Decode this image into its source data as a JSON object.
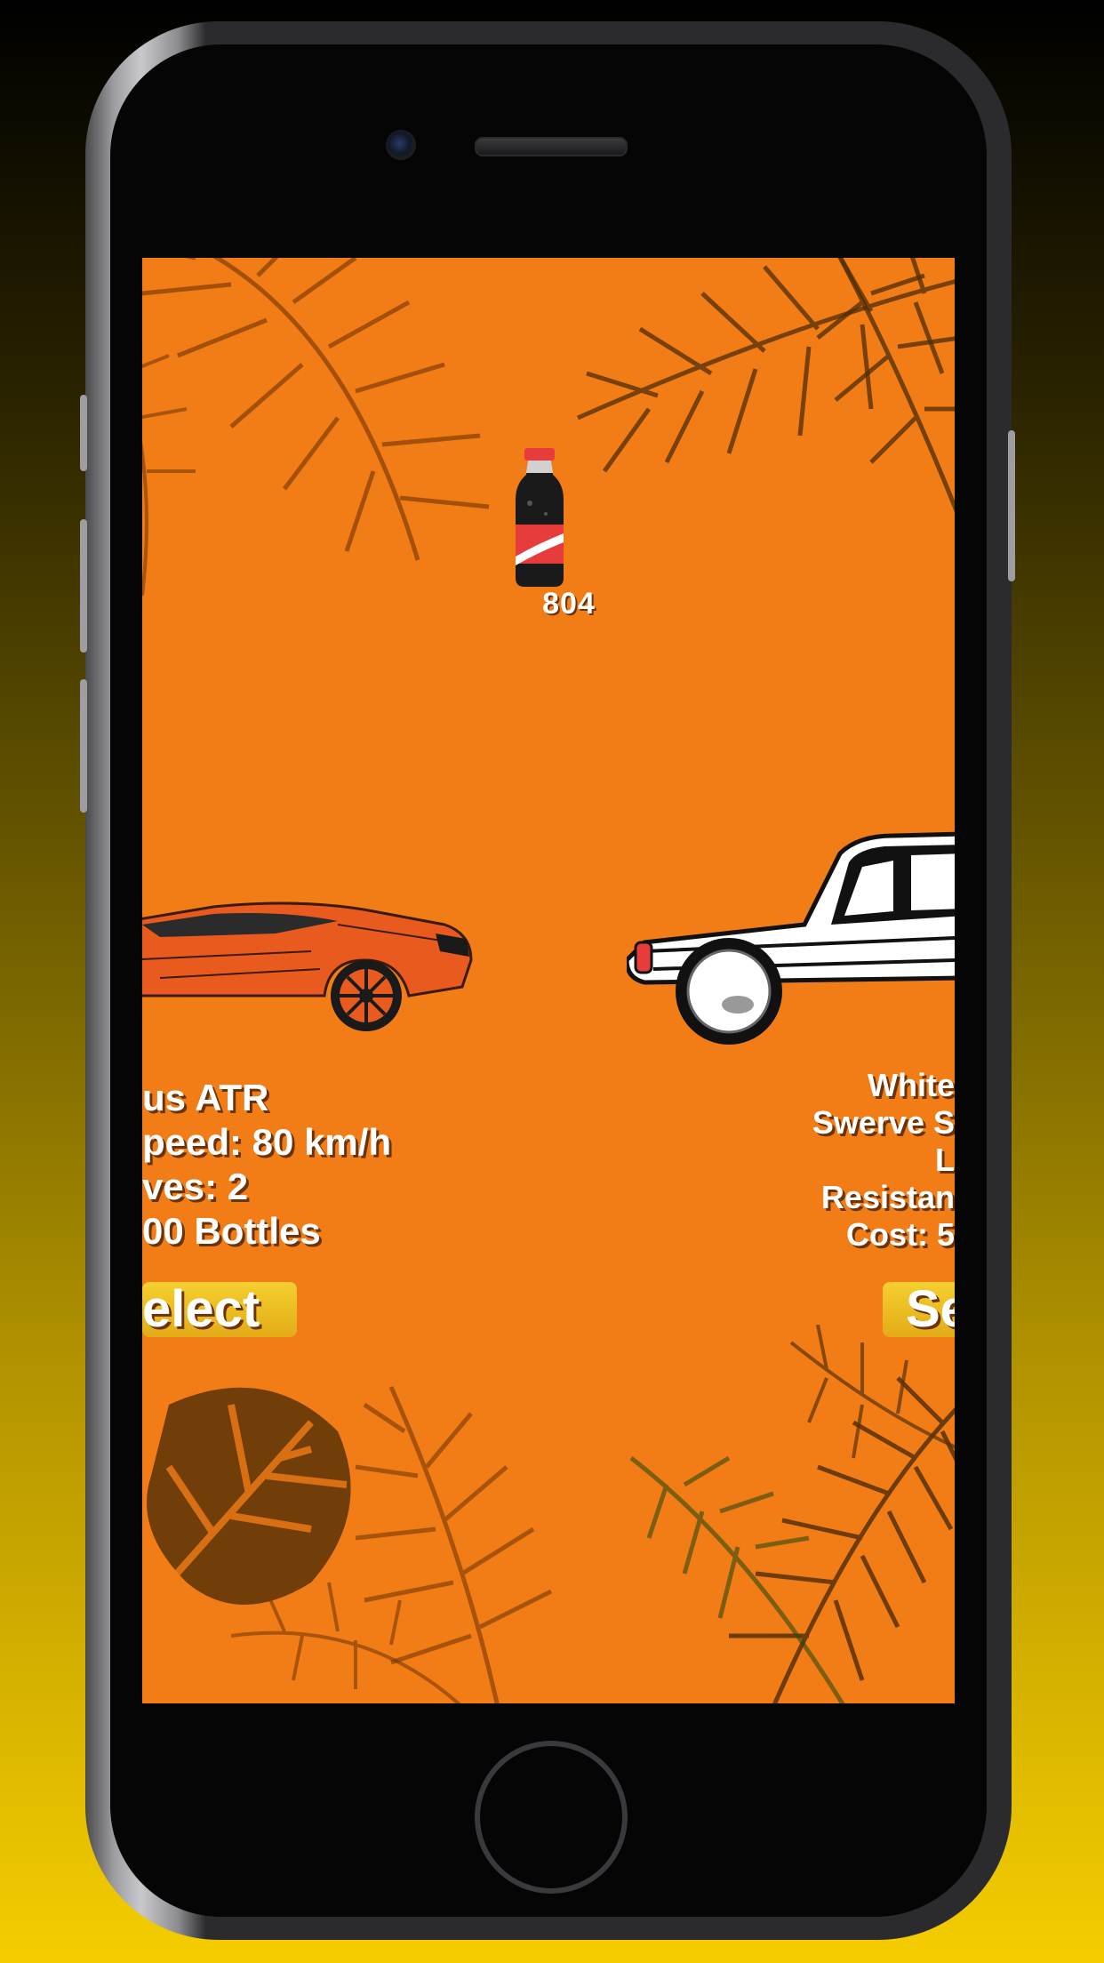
{
  "bottle_counter": "804",
  "cars": [
    {
      "name_label": "us ATR",
      "speed_label": "peed: 80 km/h",
      "lives_label": "ves: 2",
      "cost_label": "00 Bottles",
      "select_label": "elect"
    },
    {
      "name_label": "White",
      "swerve_label": "Swerve S",
      "lives_label": "L",
      "resistance_label": "Resistan",
      "cost_label": "Cost: 5",
      "select_label": "Se"
    }
  ],
  "colors": {
    "background": "#f27d16",
    "button": "#eabb22",
    "text": "#ffffff"
  }
}
